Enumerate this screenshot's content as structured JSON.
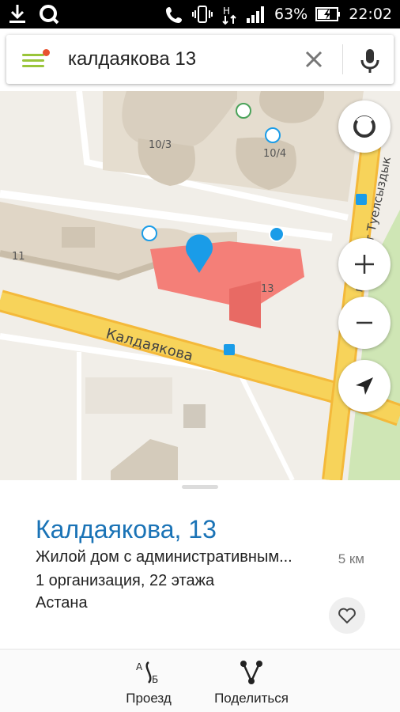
{
  "status_bar": {
    "battery": "63%",
    "time": "22:02"
  },
  "search": {
    "query": "калдаякова 13"
  },
  "map": {
    "building_labels": [
      "10/3",
      "10/4",
      "11",
      "13"
    ],
    "street_main": "Калдаякова",
    "street_side": "проспект Туелсыздык",
    "colors": {
      "selected_building": "#f47f78",
      "road": "#f7d35a",
      "building": "#e5ddcf",
      "background": "#f1eee8",
      "pin": "#1a9ce8"
    }
  },
  "place": {
    "title": "Калдаякова, 13",
    "description": "Жилой дом с административным...",
    "distance": "5 км",
    "organizations": "1 организация, 22 этажа",
    "city": "Астана"
  },
  "actions": {
    "route": "Проезд",
    "share": "Поделиться"
  }
}
